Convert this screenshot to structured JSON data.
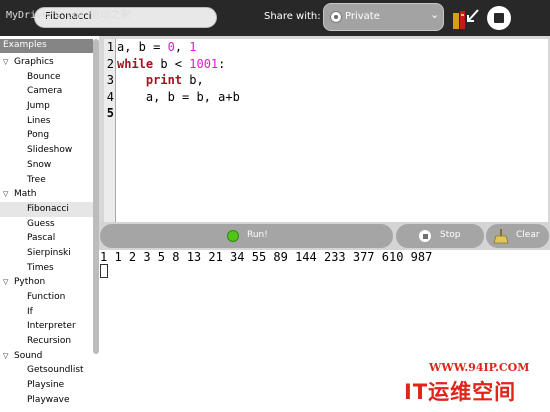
{
  "watermark_top": "MyDrivers.com 驱动之家",
  "toolbar": {
    "title": "Fibonacci",
    "share_label": "Share with:",
    "share_value": "Private",
    "share_options": [
      "Private"
    ],
    "icons": {
      "share": "radio-icon",
      "dropdown": "chevron-down-icon",
      "open": "open-books-icon",
      "stop": "stop-icon"
    }
  },
  "sidebar": {
    "header": "Examples",
    "selected": "Fibonacci",
    "categories": [
      {
        "name": "Graphics",
        "items": [
          "Bounce",
          "Camera",
          "Jump",
          "Lines",
          "Pong",
          "Slideshow",
          "Snow",
          "Tree"
        ]
      },
      {
        "name": "Math",
        "items": [
          "Fibonacci",
          "Guess",
          "Pascal",
          "Sierpinski",
          "Times"
        ]
      },
      {
        "name": "Python",
        "items": [
          "Function",
          "If",
          "Interpreter",
          "Recursion"
        ]
      },
      {
        "name": "Sound",
        "items": [
          "Getsoundlist",
          "Playsine",
          "Playwave"
        ]
      }
    ]
  },
  "editor": {
    "line_numbers": [
      "1",
      "2",
      "3",
      "4",
      "5"
    ],
    "current_line": "5",
    "lines": [
      [
        {
          "t": "a, b = ",
          "c": "plain"
        },
        {
          "t": "0",
          "c": "num"
        },
        {
          "t": ", ",
          "c": "plain"
        },
        {
          "t": "1",
          "c": "num"
        }
      ],
      [
        {
          "t": "while",
          "c": "kw"
        },
        {
          "t": " b < ",
          "c": "plain"
        },
        {
          "t": "1001",
          "c": "num"
        },
        {
          "t": ":",
          "c": "plain"
        }
      ],
      [
        {
          "t": "    ",
          "c": "plain"
        },
        {
          "t": "print",
          "c": "kw"
        },
        {
          "t": " b,",
          "c": "plain"
        }
      ],
      [
        {
          "t": "    a, b = b, a+b",
          "c": "plain"
        }
      ],
      []
    ]
  },
  "buttons": {
    "run_label": "Run!",
    "stop_label": "Stop",
    "clear_label": "Clear"
  },
  "output": {
    "text": "1 1 2 3 5 8 13 21 34 55 89 144 233 377 610 987"
  },
  "watermark_bottom": {
    "url": "WWW.94IP.COM",
    "brand": "IT运维空间"
  },
  "colors": {
    "toolbar_bg": "#282828",
    "keyword": "#a0141e",
    "number": "#e01ad0",
    "run_icon": "#52c41a",
    "watermark": "#e0241a"
  }
}
